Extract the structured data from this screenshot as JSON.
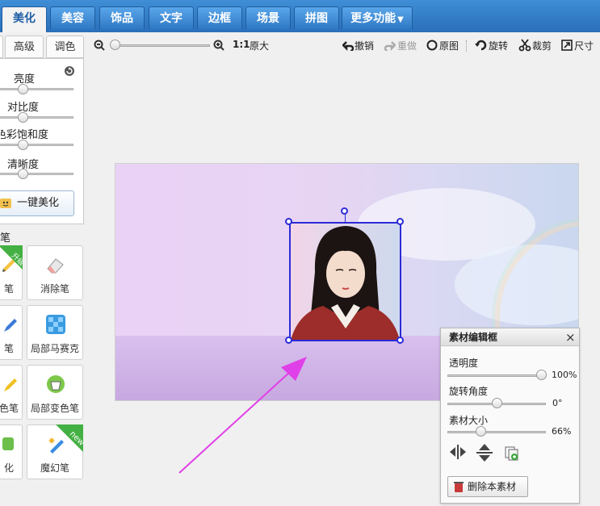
{
  "tabs": [
    {
      "label": "美化"
    },
    {
      "label": "美容"
    },
    {
      "label": "饰品"
    },
    {
      "label": "文字"
    },
    {
      "label": "边框"
    },
    {
      "label": "场景"
    },
    {
      "label": "拼图"
    },
    {
      "label": "更多功能"
    }
  ],
  "sidebar": {
    "subtabs": [
      "高级",
      "调色"
    ],
    "sliders": [
      {
        "label": "亮度"
      },
      {
        "label": "对比度"
      },
      {
        "label": "色彩饱和度"
      },
      {
        "label": "清晰度"
      }
    ],
    "one_click": "一键美化",
    "brush_section": "笔",
    "tools": [
      {
        "label": "笔",
        "badge": "升级"
      },
      {
        "label": "消除笔"
      },
      {
        "label": "笔"
      },
      {
        "label": "局部马赛克"
      },
      {
        "label": "色笔"
      },
      {
        "label": "局部变色笔"
      },
      {
        "label": "化"
      },
      {
        "label": "魔幻笔",
        "badge": "new"
      }
    ]
  },
  "toolbar": {
    "original_size_icon": "1:1",
    "original_size": "原大",
    "undo": "撤销",
    "redo": "重做",
    "original": "原图",
    "rotate": "旋转",
    "crop": "裁剪",
    "size": "尺寸"
  },
  "editor": {
    "title": "素材编辑框",
    "close": "×",
    "opacity_label": "透明度",
    "opacity_value": "100%",
    "rotation_label": "旋转角度",
    "rotation_value": "0°",
    "size_label": "素材大小",
    "size_value": "66%",
    "delete_label": "删除本素材"
  },
  "colors": {
    "tab_bg": "#2f79c4",
    "selection": "#2b2bd8",
    "arrow": "#e040e8"
  }
}
